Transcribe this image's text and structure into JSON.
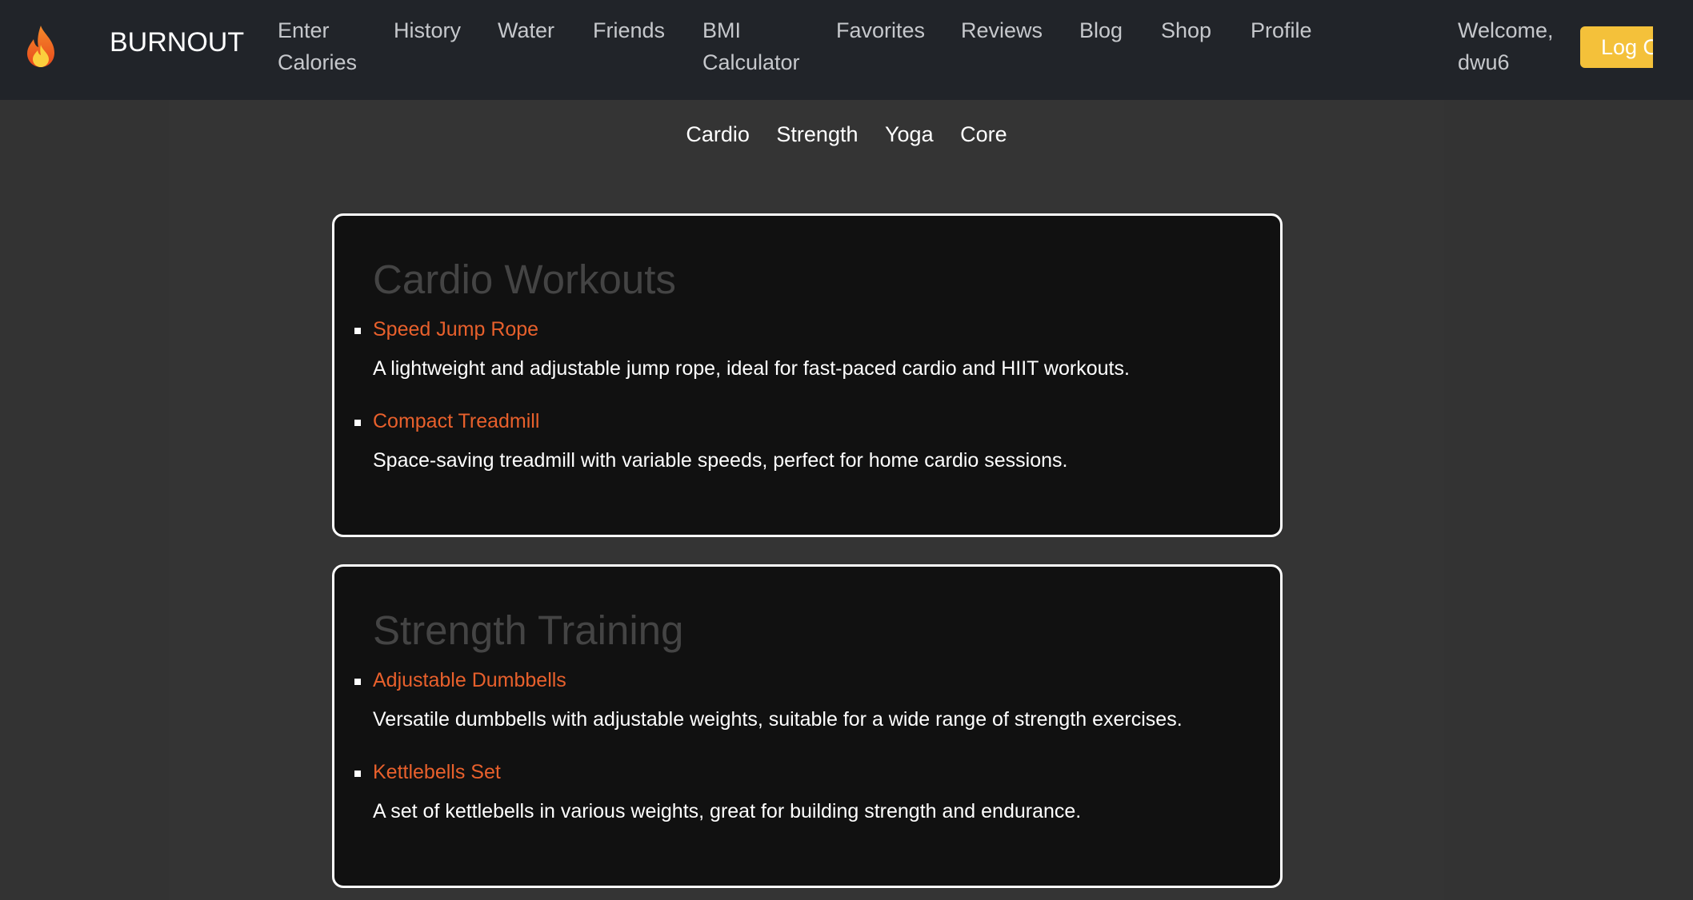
{
  "brand": {
    "name": "BURNOUT",
    "icon": "fire-icon"
  },
  "nav": {
    "enter_calories": "Enter Calories",
    "history": "History",
    "water": "Water",
    "friends": "Friends",
    "bmi": "BMI Calculator",
    "favorites": "Favorites",
    "reviews": "Reviews",
    "blog": "Blog",
    "shop": "Shop",
    "profile": "Profile"
  },
  "user": {
    "welcome": "Welcome, dwu6",
    "logout_label": "Log Out"
  },
  "subnav": [
    "Cardio",
    "Strength",
    "Yoga",
    "Core"
  ],
  "sections": [
    {
      "title": "Cardio Workouts",
      "items": [
        {
          "name": "Speed Jump Rope",
          "description": "A lightweight and adjustable jump rope, ideal for fast-paced cardio and HIIT workouts."
        },
        {
          "name": "Compact Treadmill",
          "description": "Space-saving treadmill with variable speeds, perfect for home cardio sessions."
        }
      ]
    },
    {
      "title": "Strength Training",
      "items": [
        {
          "name": "Adjustable Dumbbells",
          "description": "Versatile dumbbells with adjustable weights, suitable for a wide range of strength exercises."
        },
        {
          "name": "Kettlebells Set",
          "description": "A set of kettlebells in various weights, great for building strength and endurance."
        }
      ]
    }
  ],
  "colors": {
    "navbar": "#212429",
    "background": "#333333",
    "card": "#111111",
    "accent_link": "#e8602c",
    "logout": "#f4c13a",
    "heading": "#444444"
  }
}
